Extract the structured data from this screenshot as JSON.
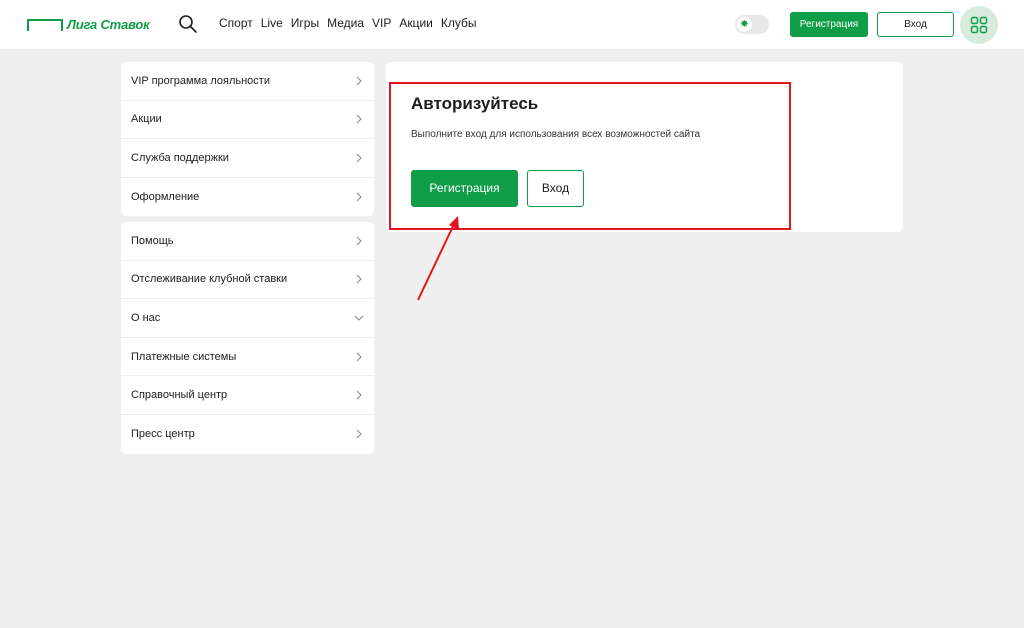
{
  "header": {
    "logo_text": "Лига Ставок",
    "nav": [
      "Спорт",
      "Live",
      "Игры",
      "Медиа",
      "VIP",
      "Акции",
      "Клубы"
    ],
    "register_label": "Регистрация",
    "login_label": "Вход",
    "accent_color": "#0f9d48"
  },
  "sidebar": {
    "group1": [
      {
        "label": "VIP программа лояльности",
        "chevron": "chevron-right-icon"
      },
      {
        "label": "Акции",
        "chevron": "chevron-right-icon"
      },
      {
        "label": "Служба поддержки",
        "chevron": "chevron-right-icon"
      },
      {
        "label": "Оформление",
        "chevron": "chevron-right-icon"
      }
    ],
    "group2": [
      {
        "label": "Помощь",
        "chevron": "chevron-right-icon"
      },
      {
        "label": "Отслеживание клубной ставки",
        "chevron": "chevron-right-icon"
      },
      {
        "label": "О нас",
        "chevron": "chevron-down-icon"
      },
      {
        "label": "Платежные системы",
        "chevron": "chevron-right-icon"
      },
      {
        "label": "Справочный центр",
        "chevron": "chevron-right-icon"
      },
      {
        "label": "Пресс центр",
        "chevron": "chevron-right-icon"
      }
    ]
  },
  "auth": {
    "title": "Авторизуйтесь",
    "subtitle": "Выполните вход для использования всех возможностей сайта",
    "register_label": "Регистрация",
    "login_label": "Вход",
    "highlight_color": "#e0151d"
  }
}
